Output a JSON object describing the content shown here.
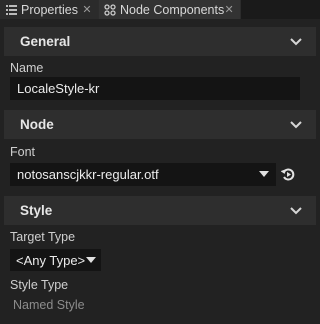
{
  "tabs": [
    {
      "label": "Properties",
      "icon": "list-icon",
      "active": false
    },
    {
      "label": "Node Components",
      "icon": "components-icon",
      "active": true
    }
  ],
  "sections": {
    "general": {
      "title": "General"
    },
    "node": {
      "title": "Node"
    },
    "style": {
      "title": "Style"
    }
  },
  "general": {
    "name_label": "Name",
    "name_value": "LocaleStyle-kr"
  },
  "node": {
    "font_label": "Font",
    "font_value": "notosanscjkkr-regular.otf"
  },
  "style": {
    "target_type_label": "Target Type",
    "target_type_value": "<Any Type>",
    "style_type_label": "Style Type",
    "style_type_value": "Named Style"
  },
  "colors": {
    "background": "#222222",
    "section_bar": "#2e2e2e",
    "field_bg": "#141414"
  }
}
